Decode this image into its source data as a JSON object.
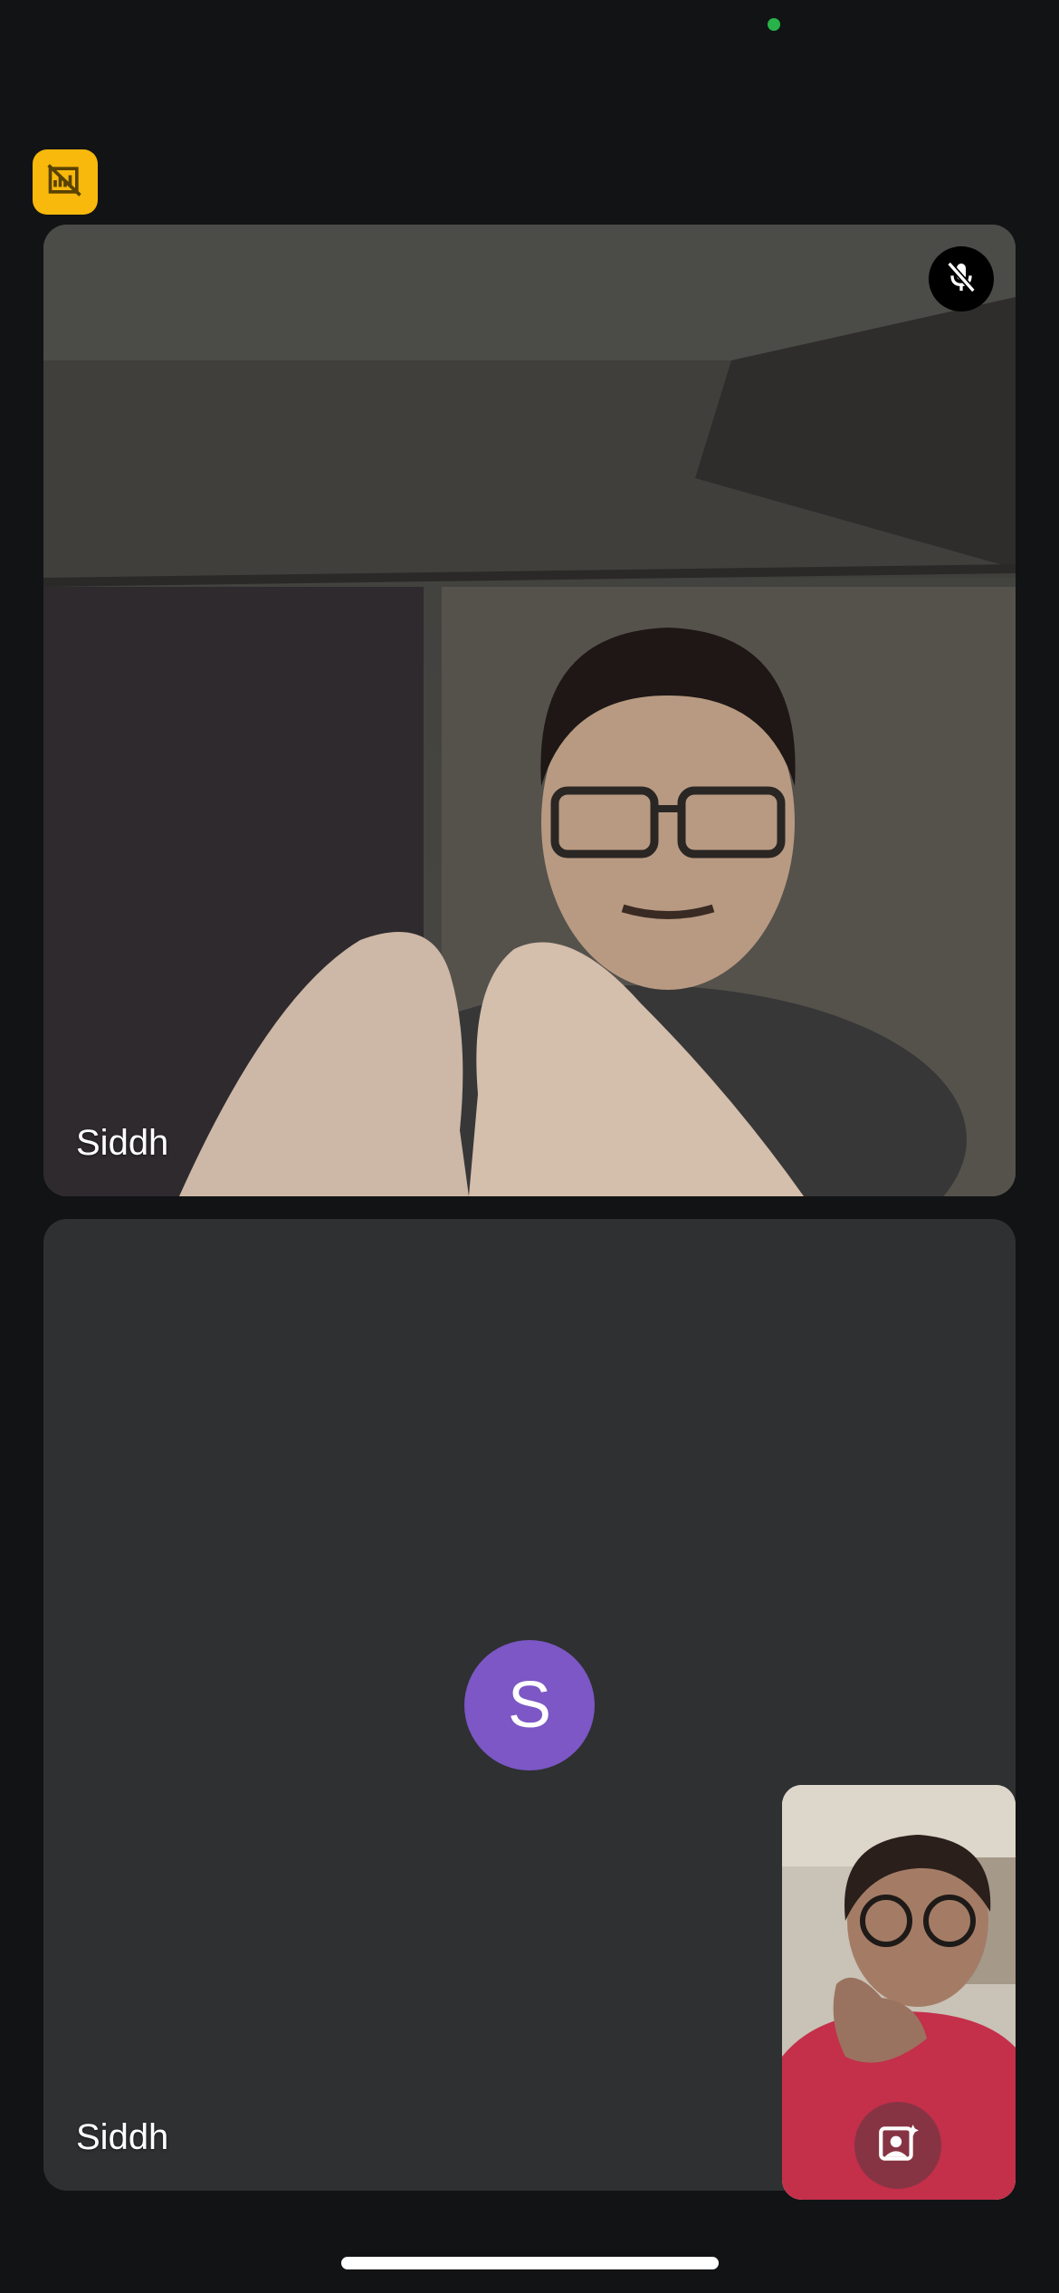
{
  "colors": {
    "background": "#121314",
    "status_dot": "#27b34a",
    "badge": "#f8b80c",
    "tile_empty": "#2e3032",
    "avatar": "#7c57c5",
    "home_indicator": "#ffffff"
  },
  "icons": {
    "badge": "no-recording-icon",
    "mute": "mic-off-icon",
    "effects": "portrait-sparkle-icon"
  },
  "participants": [
    {
      "name": "Siddh",
      "video_on": true,
      "muted": true
    },
    {
      "name": "Siddh",
      "video_on": false,
      "avatar_letter": "S"
    }
  ],
  "self_view": {
    "video_on": true
  }
}
